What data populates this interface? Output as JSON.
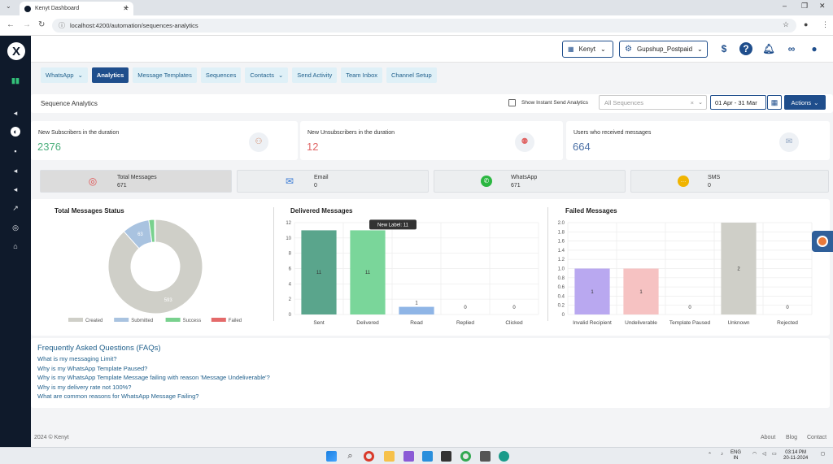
{
  "browser": {
    "tab_title": "Kenyt Dashboard",
    "url": "localhost:4200/automation/sequences-analytics"
  },
  "header": {
    "org_selector": "Kenyt",
    "account_selector": "Gupshup_Postpaid"
  },
  "nav_tabs": [
    {
      "label": "WhatsApp",
      "dropdown": true
    },
    {
      "label": "Analytics",
      "active": true
    },
    {
      "label": "Message Templates"
    },
    {
      "label": "Sequences"
    },
    {
      "label": "Contacts",
      "dropdown": true
    },
    {
      "label": "Send Activity"
    },
    {
      "label": "Team Inbox"
    },
    {
      "label": "Channel Setup"
    }
  ],
  "toolbar": {
    "page_title": "Sequence Analytics",
    "show_instant_label": "Show Instant Send Analytics",
    "sequence_placeholder": "All Sequences",
    "date_range": "01 Apr - 31 Mar",
    "actions_label": "Actions"
  },
  "stats": [
    {
      "label": "New Subscribers in the duration",
      "value": "2376",
      "color": "#4caf7d"
    },
    {
      "label": "New Unsubscribers in the duration",
      "value": "12",
      "color": "#e06666"
    },
    {
      "label": "Users who received messages",
      "value": "664",
      "color": "#4a6fa5"
    }
  ],
  "message_cards": [
    {
      "label": "Total Messages",
      "value": "671",
      "icon": "target-icon"
    },
    {
      "label": "Email",
      "value": "0",
      "icon": "envelope-icon"
    },
    {
      "label": "WhatsApp",
      "value": "671",
      "icon": "whatsapp-icon"
    },
    {
      "label": "SMS",
      "value": "0",
      "icon": "sms-icon"
    }
  ],
  "chart_data": [
    {
      "type": "pie",
      "title": "Total Messages Status",
      "categories": [
        "Created",
        "Submitted",
        "Success",
        "Failed"
      ],
      "values": [
        593,
        63,
        13,
        2
      ],
      "colors": [
        "#cfcfc8",
        "#a9c3e0",
        "#79d18e",
        "#e46a6a"
      ],
      "legend": "bottom"
    },
    {
      "type": "bar",
      "title": "Delivered Messages",
      "categories": [
        "Sent",
        "Delivered",
        "Read",
        "Replied",
        "Clicked"
      ],
      "values": [
        11,
        11,
        1,
        0,
        0
      ],
      "colors": [
        "#5aa58c",
        "#7ad69a",
        "#8fb5e6",
        "#cccccc",
        "#cccccc"
      ],
      "ylim": [
        0,
        12
      ],
      "yticks": [
        0,
        2,
        4,
        6,
        8,
        10,
        12
      ],
      "tooltip": "New Label: 11"
    },
    {
      "type": "bar",
      "title": "Failed Messages",
      "categories": [
        "Invalid Recipient",
        "Undeliverable",
        "Template Paused",
        "Unknown",
        "Rejected"
      ],
      "values": [
        1,
        1,
        0,
        2,
        0
      ],
      "colors": [
        "#b9a8f0",
        "#f6c2c2",
        "#cccccc",
        "#cfcfc8",
        "#cccccc"
      ],
      "ylim": [
        0,
        2.0
      ],
      "yticks": [
        "0",
        "0.2",
        "0.4",
        "0.6",
        "0.8",
        "1.0",
        "1.2",
        "1.4",
        "1.6",
        "1.8",
        "2.0"
      ]
    }
  ],
  "faq": {
    "title": "Frequently Asked Questions (FAQs)",
    "items": [
      "What is my messaging Limit?",
      "Why is my WhatsApp Template Paused?",
      "Why is my WhatsApp Template Message failing with reason 'Message Undeliverable'?",
      "Why is my delivery rate not 100%?",
      "What are common reasons for WhatsApp Message Failing?"
    ]
  },
  "footer": {
    "copyright": "2024 © Kenyt",
    "links": [
      "About",
      "Blog",
      "Contact"
    ]
  },
  "taskbar": {
    "lang_top": "ENG",
    "lang_bottom": "IN",
    "time": "03:14 PM",
    "date": "20-11-2024"
  }
}
